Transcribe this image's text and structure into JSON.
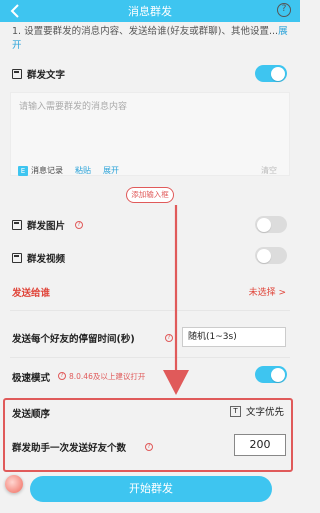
{
  "header": {
    "title": "消息群发",
    "back_icon": "back-icon",
    "help_icon": "help-icon",
    "help_glyph": "?"
  },
  "intro": {
    "text": "1. 设置要群发的消息内容、发送给谁(好友或群聊)、其他设置...",
    "more": "展开"
  },
  "text_section": {
    "label": "群发文字",
    "toggle_on": true,
    "placeholder": "请输入需要群发的消息内容",
    "history_label": "消息记录",
    "paste_label": "粘贴",
    "expand_label": "展开",
    "clear_label": "清空",
    "add_input_label": "添加输入框"
  },
  "image_section": {
    "label": "群发图片",
    "toggle_on": false
  },
  "video_section": {
    "label": "群发视频",
    "toggle_on": false
  },
  "recipients": {
    "label": "发送给谁",
    "value": "未选择 >"
  },
  "stay_time": {
    "label": "发送每个好友的停留时间(秒)",
    "value": "随机(1~3s)"
  },
  "fast_mode": {
    "label": "极速模式",
    "hint": "8.0.46及以上建议打开",
    "toggle_on": true
  },
  "send_order": {
    "label": "发送顺序",
    "value": "文字优先",
    "icon_glyph": "T"
  },
  "send_count": {
    "label": "群发助手一次发送好友个数",
    "value": "200"
  },
  "start_button": {
    "label": "开始群发"
  },
  "colors": {
    "accent": "#3ec5f0",
    "warning": "#e05a5a"
  }
}
